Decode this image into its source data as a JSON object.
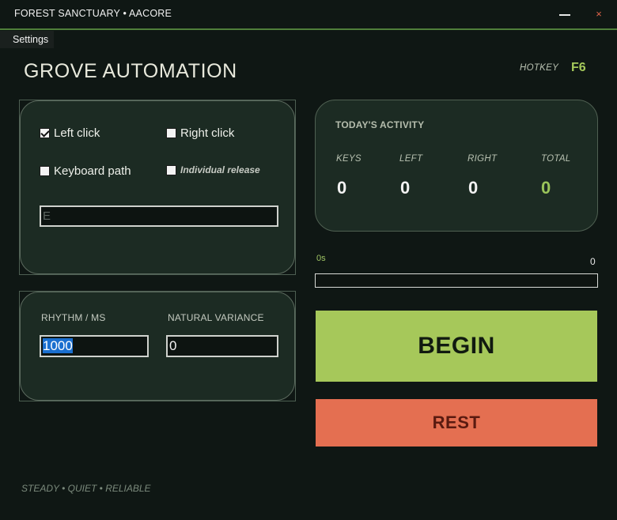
{
  "window": {
    "title": "FOREST SANCTUARY  •  AACORE",
    "close_glyph": "×",
    "minimize_icon": "minimize-icon",
    "close_icon": "close-icon"
  },
  "menu": {
    "settings": "Settings"
  },
  "header": {
    "title": "GROVE AUTOMATION",
    "hotkey_label": "HOTKEY",
    "hotkey_value": "F6"
  },
  "click_options": {
    "left_click": {
      "label": "Left click",
      "checked": true
    },
    "right_click": {
      "label": "Right click",
      "checked": false
    },
    "keyboard_path": {
      "label": "Keyboard path",
      "checked": false
    },
    "individual_release": {
      "label": "Individual release",
      "checked": false
    },
    "key_field": {
      "value": "",
      "placeholder": "E"
    }
  },
  "timing": {
    "rhythm_label": "RHYTHM / MS",
    "rhythm_value": "1000",
    "variance_label": "NATURAL VARIANCE",
    "variance_value": "0"
  },
  "activity": {
    "heading": "TODAY'S ACTIVITY",
    "stats": [
      {
        "label": "KEYS",
        "value": "0"
      },
      {
        "label": "LEFT",
        "value": "0"
      },
      {
        "label": "RIGHT",
        "value": "0"
      },
      {
        "label": "TOTAL",
        "value": "0"
      }
    ]
  },
  "progress": {
    "timer": "0s",
    "count": "0",
    "fraction": 0
  },
  "buttons": {
    "begin": "BEGIN",
    "rest": "REST"
  },
  "footer": {
    "tagline": "STEADY • QUIET • RELIABLE"
  },
  "colors": {
    "background": "#0f1714",
    "panel": "#1c2b23",
    "accent_green": "#a6c85a",
    "title_line": "#4f7f3a",
    "rest_button": "#e46f51",
    "close_glyph": "#e0644a",
    "selection": "#1a6fcf"
  }
}
